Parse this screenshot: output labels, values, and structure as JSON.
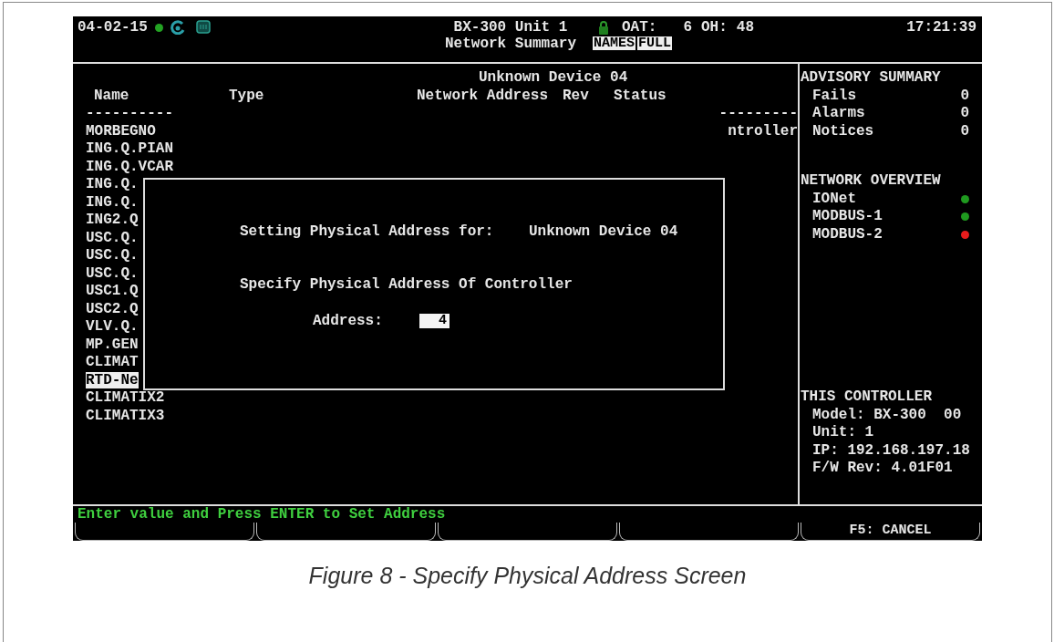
{
  "header": {
    "date": "04-02-15",
    "title": "BX-300 Unit 1",
    "subtitle": "Network Summary",
    "oat_label": "OAT:",
    "oat_value": "6",
    "oh_label": "OH:",
    "oh_value": "48",
    "time": "17:21:39",
    "toggles": [
      {
        "label": "NAMES"
      },
      {
        "label": "FULL"
      }
    ]
  },
  "device_list": {
    "title": "Unknown Device 04",
    "columns": [
      "Name",
      "Type",
      "Network Address",
      "Rev",
      "Status"
    ],
    "name_rule": "----------",
    "status_rule": "---------",
    "rows": [
      {
        "name": "MORBEGNO",
        "status": "ntroller",
        "selected": false
      },
      {
        "name": "ING.Q.PIAN",
        "selected": false
      },
      {
        "name": "ING.Q.VCAR",
        "selected": false
      },
      {
        "name": "ING.Q.",
        "selected": false
      },
      {
        "name": "ING.Q.",
        "selected": false
      },
      {
        "name": "ING2.Q",
        "selected": false
      },
      {
        "name": "USC.Q.",
        "selected": false
      },
      {
        "name": "USC.Q.",
        "selected": false
      },
      {
        "name": "USC.Q.",
        "selected": false
      },
      {
        "name": "USC1.Q",
        "selected": false
      },
      {
        "name": "USC2.Q",
        "selected": false
      },
      {
        "name": "VLV.Q.",
        "selected": false
      },
      {
        "name": "MP.GEN",
        "selected": false
      },
      {
        "name": "CLIMAT",
        "selected": false
      },
      {
        "name": "RTD-Ne",
        "selected": true
      },
      {
        "name": "CLIMATIX2",
        "selected": false
      },
      {
        "name": "CLIMATIX3",
        "selected": false
      }
    ]
  },
  "dialog": {
    "line1_label": "Setting Physical Address for:",
    "line1_value": "Unknown Device 04",
    "prompt": "Specify Physical Address Of Controller",
    "field_label": "Address:",
    "field_value": "4"
  },
  "advisory_summary": {
    "title": "ADVISORY SUMMARY",
    "items": [
      {
        "label": "Fails",
        "value": "0"
      },
      {
        "label": "Alarms",
        "value": "0"
      },
      {
        "label": "Notices",
        "value": "0"
      }
    ]
  },
  "network_overview": {
    "title": "NETWORK OVERVIEW",
    "items": [
      {
        "label": "IONet",
        "color": "#1f9a1f"
      },
      {
        "label": "MODBUS-1",
        "color": "#1f9a1f"
      },
      {
        "label": "MODBUS-2",
        "color": "#e81c1c"
      }
    ]
  },
  "this_controller": {
    "title": "THIS CONTROLLER",
    "lines": [
      "Model: BX-300  00",
      "Unit: 1",
      "IP: 192.168.197.18",
      "F/W Rev: 4.01F01"
    ]
  },
  "status_message": "Enter value and Press ENTER to Set Address",
  "function_keys": [
    {
      "kind": "blank"
    },
    {
      "kind": "blank"
    },
    {
      "kind": "blank"
    },
    {
      "kind": "blank"
    },
    {
      "kind": "key",
      "label": "F5: CANCEL"
    }
  ],
  "caption": "Figure 8 - Specify Physical Address Screen"
}
